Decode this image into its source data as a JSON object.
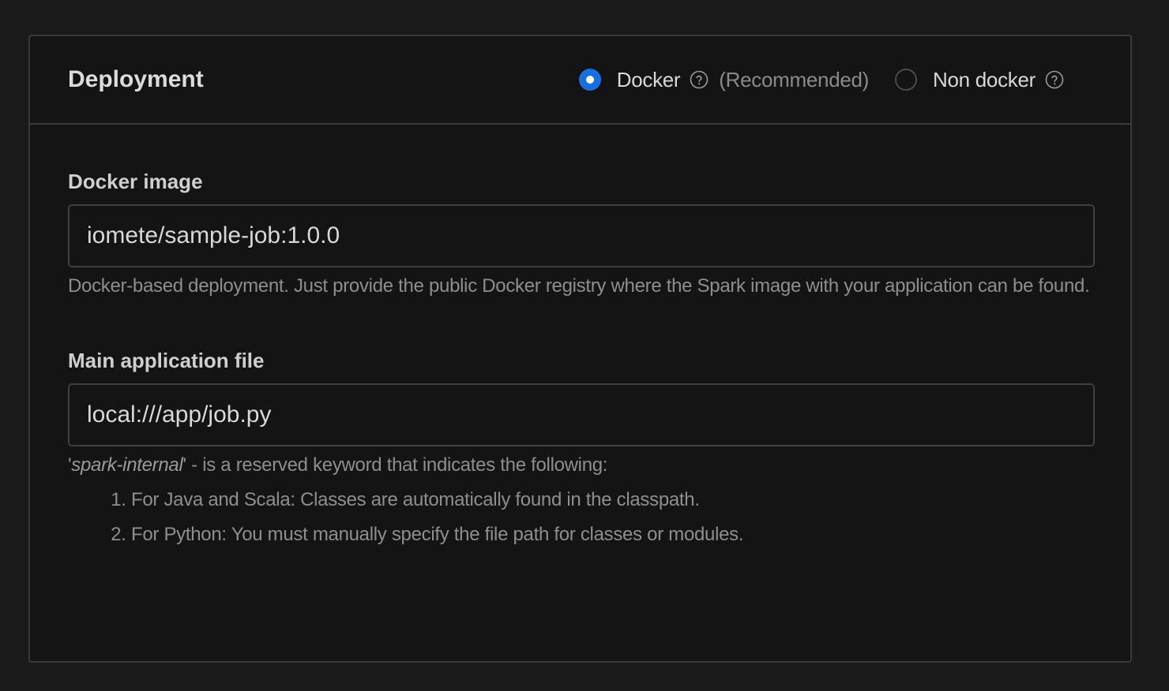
{
  "section": {
    "title": "Deployment"
  },
  "deployment_type": {
    "options": [
      {
        "label": "Docker",
        "checked": true,
        "suffix": "(Recommended)"
      },
      {
        "label": "Non docker",
        "checked": false
      }
    ]
  },
  "docker_image": {
    "label": "Docker image",
    "value": "iomete/sample-job:1.0.0",
    "help": "Docker-based deployment. Just provide the public Docker registry where the Spark image with your application can be found."
  },
  "main_file": {
    "label": "Main application file",
    "value": "local:///app/job.py",
    "help_quote_open": "'",
    "help_keyword": "spark-internal",
    "help_rest": "' - is a reserved keyword that indicates the following:",
    "help_items": [
      "For Java and Scala: Classes are automatically found in the classpath.",
      "For Python: You must manually specify the file path for classes or modules."
    ]
  },
  "colors": {
    "accent": "#1a6fe0",
    "background": "#141414",
    "border": "#3a3a3a"
  },
  "icons": {
    "help": "question-circle-icon"
  }
}
